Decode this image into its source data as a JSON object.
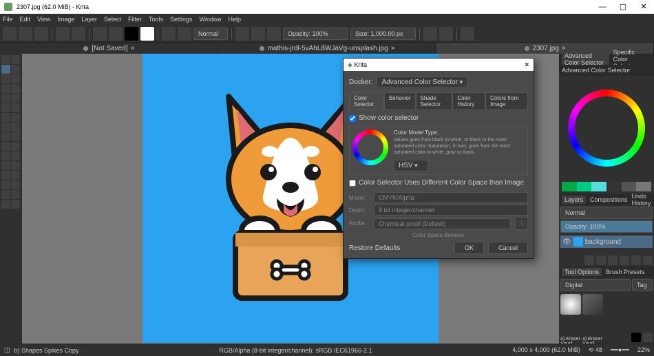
{
  "title": "2307.jpg (62.0 MiB) - Krita",
  "menu": [
    "File",
    "Edit",
    "View",
    "Image",
    "Layer",
    "Select",
    "Filter",
    "Tools",
    "Settings",
    "Window",
    "Help"
  ],
  "toolbar": {
    "blend": "Normal",
    "opacity_label": "Opacity: 100%",
    "size_label": "Size: 1,000.00 px"
  },
  "tabs": [
    {
      "name": "[Not Saved]"
    },
    {
      "name": "mathis-jrdl-5vAhL8WJaVg-unsplash.jpg"
    },
    {
      "name": "2307.jpg"
    }
  ],
  "rpanel": {
    "adv_title": "Advanced Color Selector",
    "spec_title": "Specific Color Selector",
    "hdr2": "Advanced Color Selector",
    "layers_tab": "Layers",
    "comp_tab": "Compositions",
    "undo_tab": "Undo History",
    "blend": "Normal",
    "opacity": "Opacity: 100%",
    "layer": "background",
    "toolopt": "Tool Options",
    "brushp": "Brush Presets",
    "digital": "Digital",
    "tag": "Tag",
    "eraser1": "a) Eraser Small",
    "eraser2": "a) Eraser Small"
  },
  "dialog": {
    "title": "Krita",
    "docker_label": "Docker:",
    "docker_value": "Advanced Color Selector",
    "tabs": [
      "Color Selector",
      "Behavior",
      "Shade Selector",
      "Color History",
      "Colors from Image"
    ],
    "show_cs": "Show color selector",
    "model_label": "Color Model Type:",
    "model_desc": "Values goes from black to white, or black to the most saturated color. Saturation, in turn, goes from the most saturated color to white, gray or black.",
    "hsv": "HSV",
    "diff": "Color Selector Uses Different Color Space than Image",
    "model": "Model:",
    "model_v": "CMYK/Alpha",
    "depth": "Depth:",
    "depth_v": "8 bit integer/channel",
    "profile": "Profile:",
    "profile_v": "Chemical proof (Default)",
    "browse": "Color Space Browser",
    "restore": "Restore Defaults",
    "ok": "OK",
    "cancel": "Cancel"
  },
  "status": {
    "left": "b) Shapes Spikes Copy",
    "mid": "RGB/Alpha (8-bit integer/channel): sRGB IEC61966-2.1",
    "dim": "4,000 x 4,000 (62.0 MiB)",
    "zoom": "22%"
  }
}
